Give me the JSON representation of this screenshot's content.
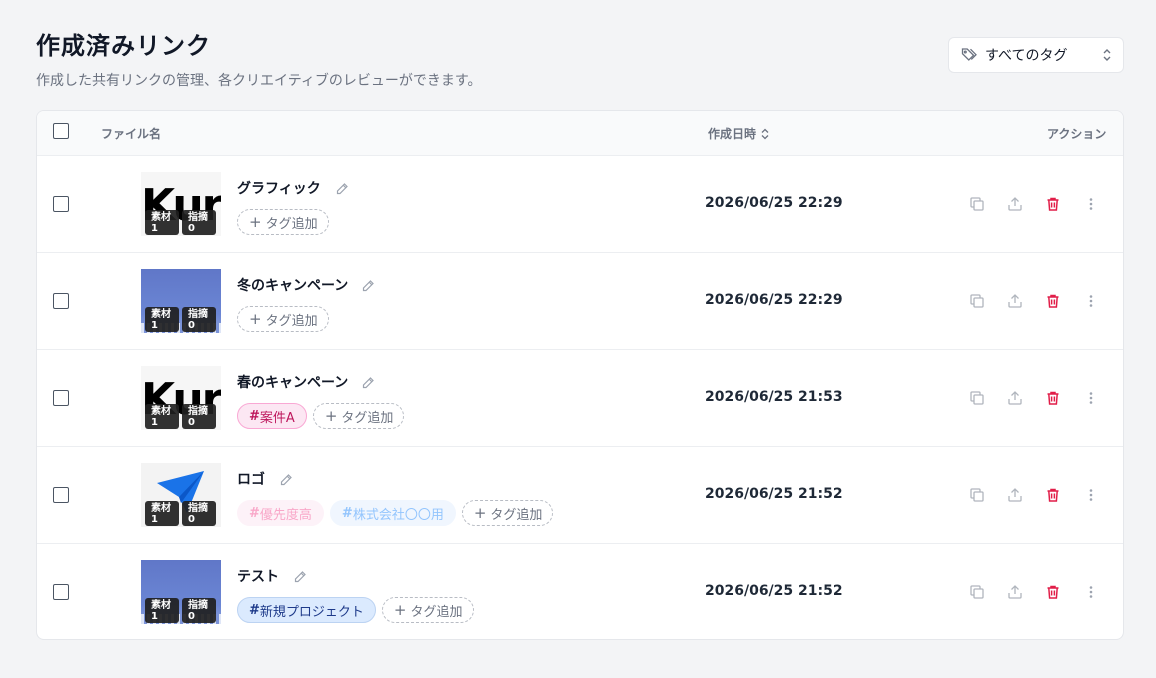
{
  "page": {
    "title": "作成済みリンク",
    "subtitle": "作成した共有リンクの管理、各クリエイティブのレビューができます。"
  },
  "filter": {
    "label": "すべてのタグ",
    "icon": "tag-icon"
  },
  "table": {
    "columns": {
      "file_name": "ファイル名",
      "created_at": "作成日時",
      "actions": "アクション"
    },
    "add_tag_label": "タグ追加",
    "rows": [
      {
        "name": "グラフィック",
        "date": "2026/06/25 22:29",
        "thumb": "kur",
        "thumb_text": "Kur",
        "badges": [
          {
            "label": "素材",
            "count": "1"
          },
          {
            "label": "指摘",
            "count": "0"
          }
        ],
        "tags": []
      },
      {
        "name": "冬のキャンペーン",
        "date": "2026/06/25 22:29",
        "thumb": "winter",
        "badges": [
          {
            "label": "素材",
            "count": "1"
          },
          {
            "label": "指摘",
            "count": "0"
          }
        ],
        "tags": []
      },
      {
        "name": "春のキャンペーン",
        "date": "2026/06/25 21:53",
        "thumb": "kur",
        "thumb_text": "Kur",
        "badges": [
          {
            "label": "素材",
            "count": "1"
          },
          {
            "label": "指摘",
            "count": "0"
          }
        ],
        "tags": [
          {
            "hash": "#",
            "text": "案件A",
            "color": "#be185d",
            "bg": "#fce7f3",
            "border": "#f9a8d4"
          }
        ]
      },
      {
        "name": "ロゴ",
        "date": "2026/06/25 21:52",
        "thumb": "rogo",
        "badges": [
          {
            "label": "素材",
            "count": "1"
          },
          {
            "label": "指摘",
            "count": "0"
          }
        ],
        "tags": [
          {
            "hash": "#",
            "text": "優先度高",
            "color": "#f9a8c9",
            "bg": "#fdf2f8",
            "border": "#fdf2f8"
          },
          {
            "hash": "#",
            "text": "株式会社〇〇用",
            "color": "#93c5fd",
            "bg": "#f0f6fe",
            "border": "#f0f6fe"
          }
        ]
      },
      {
        "name": "テスト",
        "date": "2026/06/25 21:52",
        "thumb": "winter",
        "badges": [
          {
            "label": "素材",
            "count": "1"
          },
          {
            "label": "指摘",
            "count": "0"
          }
        ],
        "tags": [
          {
            "hash": "#",
            "text": "新規プロジェクト",
            "color": "#1e3a8a",
            "bg": "#dbeafe",
            "border": "#bcd3f2"
          }
        ]
      }
    ]
  },
  "colors": {
    "delete": "#e11d48",
    "icon_gray": "#9ca3af"
  }
}
